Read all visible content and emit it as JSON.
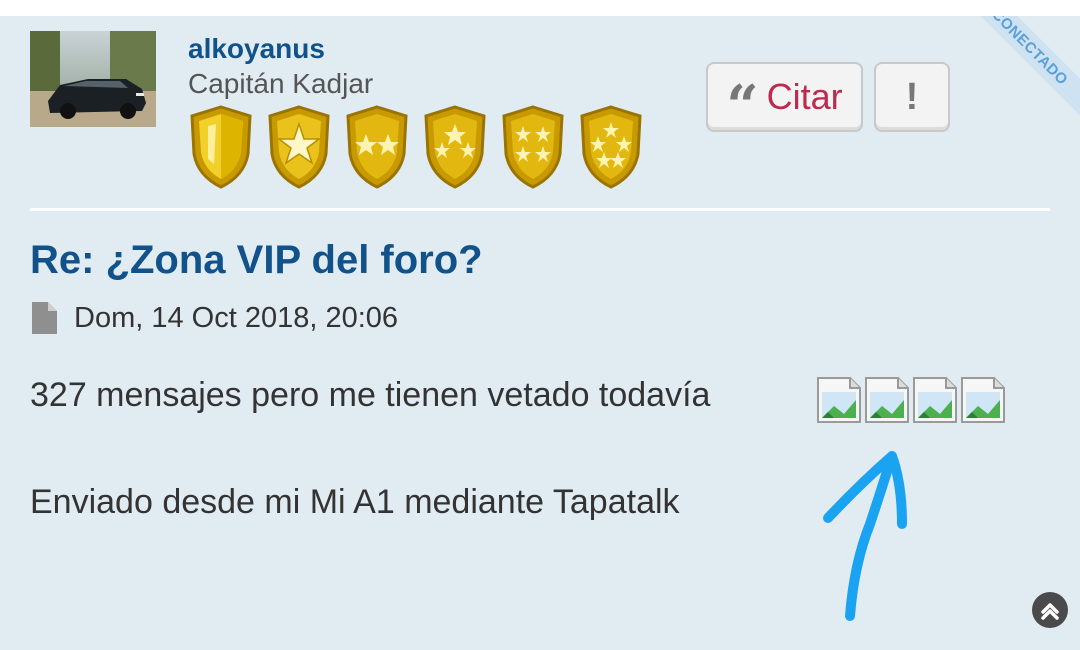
{
  "post": {
    "author": {
      "username": "alkoyanus",
      "rank": "Capitán Kadjar",
      "status_ribbon": "CONECTADO",
      "rank_badges": [
        "shield-blank",
        "shield-1-star",
        "shield-2-stars",
        "shield-3-stars",
        "shield-4-stars",
        "shield-5-stars"
      ]
    },
    "actions": {
      "quote_label": "Citar",
      "quote_icon": "quote-icon",
      "report_label": "!"
    },
    "title": "Re: ¿Zona VIP del foro?",
    "date": "Dom, 14 Oct 2018, 20:06",
    "body": {
      "line1": "327 mensajes pero me tienen vetado todavía",
      "line2": "Enviado desde mi Mi A1 mediante Tapatalk"
    },
    "broken_image_icons": [
      "broken-image-icon",
      "broken-image-icon",
      "broken-image-icon",
      "broken-image-icon"
    ]
  },
  "colors": {
    "post_background": "#e1ebf2",
    "link_blue": "#105289",
    "quote_red": "#bc2a4d",
    "annotation_blue": "#1aa3f0",
    "badge_gold": "#d4a400"
  }
}
